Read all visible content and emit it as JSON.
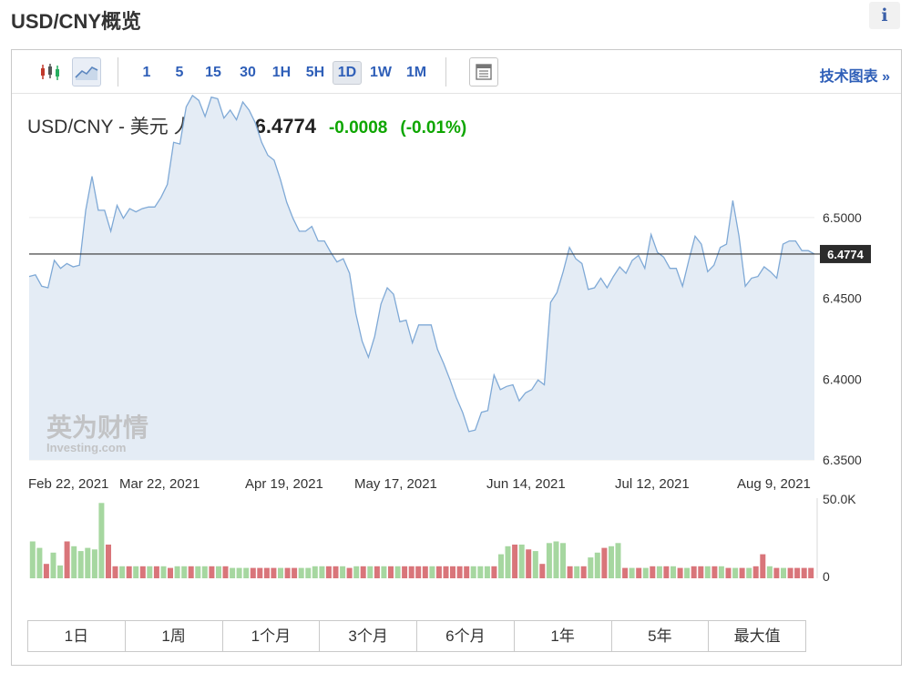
{
  "header": {
    "title": "USD/CNY概览",
    "info_icon": "i"
  },
  "toolbar": {
    "intervals": [
      "1",
      "5",
      "15",
      "30",
      "1H",
      "5H",
      "1D",
      "1W",
      "1M"
    ],
    "active_interval": "1D",
    "tech_chart_link": "技术图表 »"
  },
  "quote": {
    "name": "USD/CNY - 美元 人民币",
    "price": "6.4774",
    "change": "-0.0008",
    "change_pct": "(-0.01%)",
    "change_color": "#0ea600"
  },
  "watermark": {
    "cn": "英为财情",
    "en": "Investing.com"
  },
  "range_buttons": [
    "1日",
    "1周",
    "1个月",
    "3个月",
    "6个月",
    "1年",
    "5年",
    "最大值"
  ],
  "chart_data": {
    "type": "area",
    "y_ticks": [
      "6.5000",
      "6.4500",
      "6.4000",
      "6.3500"
    ],
    "ylim": [
      6.35,
      6.545
    ],
    "x_labels": [
      "Feb 22, 2021",
      "Mar 22, 2021",
      "Apr 19, 2021",
      "May 17, 2021",
      "Jun 14, 2021",
      "Jul 12, 2021",
      "Aug 9, 2021"
    ],
    "current_price": 6.4774,
    "current_price_label": "6.4774",
    "series": [
      {
        "values": [
          6.4635,
          6.4645,
          6.4575,
          6.4565,
          6.4735,
          6.4685,
          6.4715,
          6.4695,
          6.4705,
          6.5045,
          6.5255,
          6.5045,
          6.5045,
          6.4915,
          6.5075,
          6.4995,
          6.5055,
          6.5035,
          6.5055,
          6.5065,
          6.5065,
          6.5125,
          6.5205,
          6.5465,
          6.5455,
          6.5685,
          6.5755,
          6.5725,
          6.5625,
          6.5745,
          6.5735,
          6.5615,
          6.5665,
          6.5605,
          6.5715,
          6.5665,
          6.5585,
          6.5465,
          6.5385,
          6.5355,
          6.5235,
          6.5095,
          6.4995,
          6.4915,
          6.4915,
          6.4945,
          6.4855,
          6.4855,
          6.4785,
          6.4725,
          6.4745,
          6.4655,
          6.4405,
          6.4235,
          6.4135,
          6.4265,
          6.4465,
          6.4565,
          6.4525,
          6.4355,
          6.4365,
          6.4225,
          6.4335,
          6.4335,
          6.4335,
          6.4185,
          6.4095,
          6.3995,
          6.3885,
          6.3795,
          6.3675,
          6.3685,
          6.3795,
          6.3805,
          6.4025,
          6.3935,
          6.3955,
          6.3965,
          6.3865,
          6.3915,
          6.3935,
          6.3995,
          6.3965,
          6.4475,
          6.4535,
          6.4665,
          6.4815,
          6.4745,
          6.4715,
          6.4555,
          6.4565,
          6.4625,
          6.4565,
          6.4635,
          6.4695,
          6.4655,
          6.4735,
          6.4765,
          6.4685,
          6.4895,
          6.4785,
          6.4755,
          6.4685,
          6.4685,
          6.4575,
          6.4735,
          6.4885,
          6.4835,
          6.4665,
          6.4705,
          6.4815,
          6.4835,
          6.5105,
          6.4885,
          6.4575,
          6.4625,
          6.4635,
          6.4695,
          6.4665,
          6.4625,
          6.4835,
          6.4855,
          6.4855,
          6.4795,
          6.4795,
          6.4774
        ]
      }
    ],
    "volume": {
      "y_ticks": [
        "50.0K",
        "0"
      ],
      "ymax": 50000,
      "bars": [
        {
          "v": 23000,
          "up": true
        },
        {
          "v": 19000,
          "up": true
        },
        {
          "v": 9000,
          "up": false
        },
        {
          "v": 16000,
          "up": true
        },
        {
          "v": 8000,
          "up": true
        },
        {
          "v": 23000,
          "up": false
        },
        {
          "v": 20000,
          "up": true
        },
        {
          "v": 17000,
          "up": true
        },
        {
          "v": 19000,
          "up": true
        },
        {
          "v": 18000,
          "up": true
        },
        {
          "v": 47000,
          "up": true
        },
        {
          "v": 21000,
          "up": false
        },
        {
          "v": 7500,
          "up": false
        },
        {
          "v": 7500,
          "up": true
        },
        {
          "v": 7500,
          "up": false
        },
        {
          "v": 7500,
          "up": true
        },
        {
          "v": 7500,
          "up": false
        },
        {
          "v": 7500,
          "up": true
        },
        {
          "v": 7500,
          "up": false
        },
        {
          "v": 7500,
          "up": true
        },
        {
          "v": 6500,
          "up": false
        },
        {
          "v": 7500,
          "up": true
        },
        {
          "v": 7500,
          "up": true
        },
        {
          "v": 7500,
          "up": false
        },
        {
          "v": 7500,
          "up": true
        },
        {
          "v": 7500,
          "up": true
        },
        {
          "v": 7500,
          "up": false
        },
        {
          "v": 7500,
          "up": true
        },
        {
          "v": 7500,
          "up": false
        },
        {
          "v": 6500,
          "up": true
        },
        {
          "v": 6500,
          "up": true
        },
        {
          "v": 6500,
          "up": true
        },
        {
          "v": 6500,
          "up": false
        },
        {
          "v": 6500,
          "up": false
        },
        {
          "v": 6500,
          "up": false
        },
        {
          "v": 6500,
          "up": false
        },
        {
          "v": 6500,
          "up": true
        },
        {
          "v": 6500,
          "up": false
        },
        {
          "v": 6500,
          "up": false
        },
        {
          "v": 6500,
          "up": true
        },
        {
          "v": 6500,
          "up": true
        },
        {
          "v": 7500,
          "up": true
        },
        {
          "v": 7500,
          "up": true
        },
        {
          "v": 7500,
          "up": false
        },
        {
          "v": 7500,
          "up": false
        },
        {
          "v": 7500,
          "up": true
        },
        {
          "v": 6500,
          "up": false
        },
        {
          "v": 7500,
          "up": true
        },
        {
          "v": 7500,
          "up": false
        },
        {
          "v": 7500,
          "up": true
        },
        {
          "v": 7500,
          "up": false
        },
        {
          "v": 7500,
          "up": true
        },
        {
          "v": 7500,
          "up": false
        },
        {
          "v": 7500,
          "up": true
        },
        {
          "v": 7500,
          "up": false
        },
        {
          "v": 7500,
          "up": false
        },
        {
          "v": 7500,
          "up": false
        },
        {
          "v": 7500,
          "up": false
        },
        {
          "v": 7500,
          "up": true
        },
        {
          "v": 7500,
          "up": false
        },
        {
          "v": 7500,
          "up": false
        },
        {
          "v": 7500,
          "up": false
        },
        {
          "v": 7500,
          "up": false
        },
        {
          "v": 7500,
          "up": false
        },
        {
          "v": 7500,
          "up": true
        },
        {
          "v": 7500,
          "up": true
        },
        {
          "v": 7500,
          "up": true
        },
        {
          "v": 7500,
          "up": false
        },
        {
          "v": 15000,
          "up": true
        },
        {
          "v": 20000,
          "up": true
        },
        {
          "v": 21000,
          "up": false
        },
        {
          "v": 21000,
          "up": true
        },
        {
          "v": 18000,
          "up": false
        },
        {
          "v": 17000,
          "up": true
        },
        {
          "v": 9000,
          "up": false
        },
        {
          "v": 22000,
          "up": true
        },
        {
          "v": 23000,
          "up": true
        },
        {
          "v": 22000,
          "up": true
        },
        {
          "v": 7500,
          "up": false
        },
        {
          "v": 7500,
          "up": true
        },
        {
          "v": 7500,
          "up": false
        },
        {
          "v": 13000,
          "up": true
        },
        {
          "v": 16000,
          "up": true
        },
        {
          "v": 19000,
          "up": false
        },
        {
          "v": 20000,
          "up": true
        },
        {
          "v": 22000,
          "up": true
        },
        {
          "v": 6500,
          "up": false
        },
        {
          "v": 6500,
          "up": true
        },
        {
          "v": 6500,
          "up": false
        },
        {
          "v": 6500,
          "up": true
        },
        {
          "v": 7500,
          "up": false
        },
        {
          "v": 7500,
          "up": true
        },
        {
          "v": 7500,
          "up": false
        },
        {
          "v": 7500,
          "up": true
        },
        {
          "v": 6500,
          "up": false
        },
        {
          "v": 6500,
          "up": true
        },
        {
          "v": 7500,
          "up": false
        },
        {
          "v": 7500,
          "up": false
        },
        {
          "v": 7500,
          "up": true
        },
        {
          "v": 7500,
          "up": false
        },
        {
          "v": 7500,
          "up": true
        },
        {
          "v": 6500,
          "up": false
        },
        {
          "v": 6500,
          "up": true
        },
        {
          "v": 6500,
          "up": false
        },
        {
          "v": 6500,
          "up": true
        },
        {
          "v": 7500,
          "up": false
        },
        {
          "v": 15000,
          "up": false
        },
        {
          "v": 7500,
          "up": true
        },
        {
          "v": 6500,
          "up": false
        },
        {
          "v": 6500,
          "up": true
        },
        {
          "v": 6500,
          "up": false
        },
        {
          "v": 6500,
          "up": false
        },
        {
          "v": 6500,
          "up": false
        },
        {
          "v": 6500,
          "up": false
        }
      ]
    },
    "colors": {
      "line": "#7fa9d6",
      "fill": "#e4ecf5",
      "up": "#a6d7a0",
      "down": "#d9757a",
      "price_line": "#333333"
    }
  }
}
